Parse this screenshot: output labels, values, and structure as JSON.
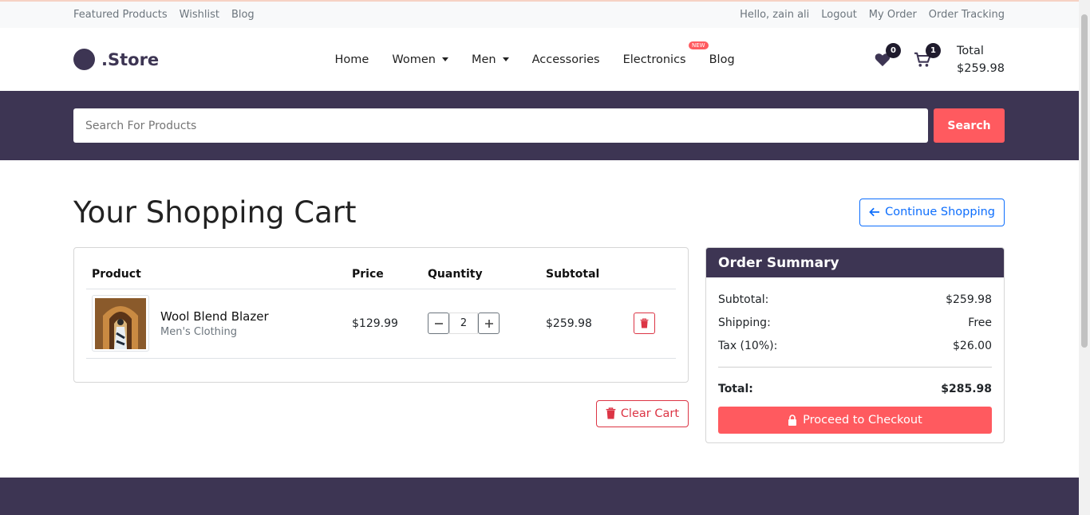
{
  "topbar": {
    "left": [
      "Featured Products",
      "Wishlist",
      "Blog"
    ],
    "greeting": "Hello, zain ali",
    "right": [
      "Logout",
      "My Order",
      "Order Tracking"
    ]
  },
  "header": {
    "brand": ".Store",
    "nav": {
      "home": "Home",
      "women": "Women",
      "men": "Men",
      "accessories": "Accessories",
      "electronics": "Electronics",
      "new_badge": "NEW",
      "blog": "Blog"
    },
    "wishlist_count": "0",
    "cart_count": "1",
    "total_label": "Total",
    "total_value": "$259.98"
  },
  "search": {
    "placeholder": "Search For Products",
    "button": "Search"
  },
  "page": {
    "title": "Your Shopping Cart",
    "continue_label": "Continue Shopping"
  },
  "cart": {
    "headers": [
      "Product",
      "Price",
      "Quantity",
      "Subtotal"
    ],
    "items": [
      {
        "name": "Wool Blend Blazer",
        "category": "Men's Clothing",
        "price": "$129.99",
        "quantity": "2",
        "subtotal": "$259.98"
      }
    ],
    "clear_label": "Clear Cart"
  },
  "summary": {
    "title": "Order Summary",
    "subtotal_label": "Subtotal:",
    "subtotal_value": "$259.98",
    "shipping_label": "Shipping:",
    "shipping_value": "Free",
    "tax_label": "Tax (10%):",
    "tax_value": "$26.00",
    "total_label": "Total:",
    "total_value": "$285.98",
    "checkout_label": "Proceed to Checkout"
  },
  "colors": {
    "brand": "#3d3553",
    "accent": "#ff5a5f",
    "link": "#0d6efd",
    "danger": "#dc3545"
  }
}
